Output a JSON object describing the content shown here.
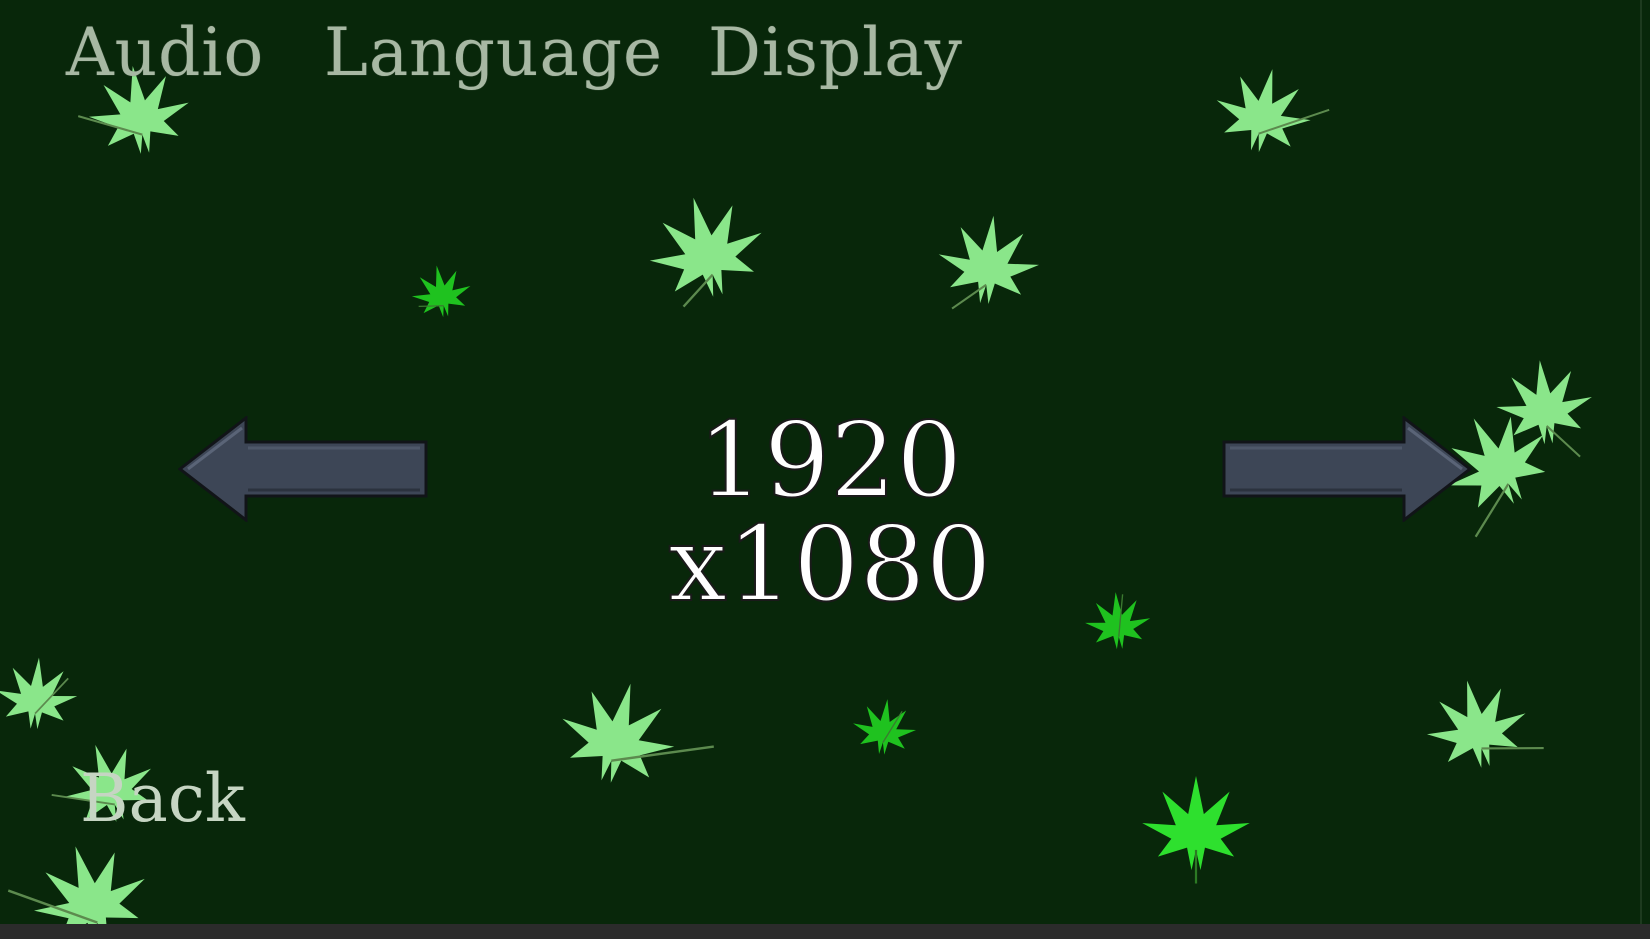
{
  "tabs": {
    "audio": "Audio",
    "language": "Language",
    "display": "Display"
  },
  "display": {
    "resolution": "1920 x1080"
  },
  "back_label": "Back",
  "icons": {
    "left": "arrow-left-icon",
    "right": "arrow-right-icon",
    "leaf": "maple-leaf-icon"
  },
  "colors": {
    "background": "#08270a",
    "tab_text": "#a7b8a3",
    "leaf_light": "#8ae68a",
    "leaf_bright": "#1fc21f",
    "arrow_fill": "#3d4656",
    "arrow_stroke": "#111418"
  }
}
